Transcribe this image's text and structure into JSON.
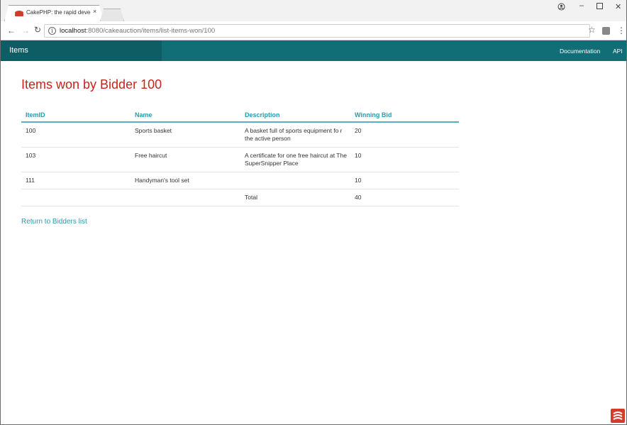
{
  "browser": {
    "tab_title": "CakePHP: the rapid deve",
    "tab_close": "×",
    "url_host": "localhost",
    "url_rest": ":8080/cakeauction/items/list-items-won/100"
  },
  "navbar": {
    "brand": "Items",
    "links": [
      "Documentation",
      "API"
    ]
  },
  "page": {
    "title": "Items won by Bidder 100",
    "return_link": "Return to Bidders list"
  },
  "table": {
    "headers": [
      "ItemID",
      "Name",
      "Description",
      "Winning Bid"
    ],
    "rows": [
      [
        "100",
        "Sports basket",
        "A basket full of sports equipment fo r the active person",
        "20"
      ],
      [
        "103",
        "Free haircut",
        "A certificate for one free haircut at The SuperSnipper Place",
        "10"
      ],
      [
        "111",
        "Handyman's tool set",
        "",
        "10"
      ],
      [
        "",
        "",
        "Total",
        "40"
      ]
    ]
  },
  "colors": {
    "navbar": "#116d76",
    "title": "#c7241b",
    "link": "#2a9bb0"
  }
}
